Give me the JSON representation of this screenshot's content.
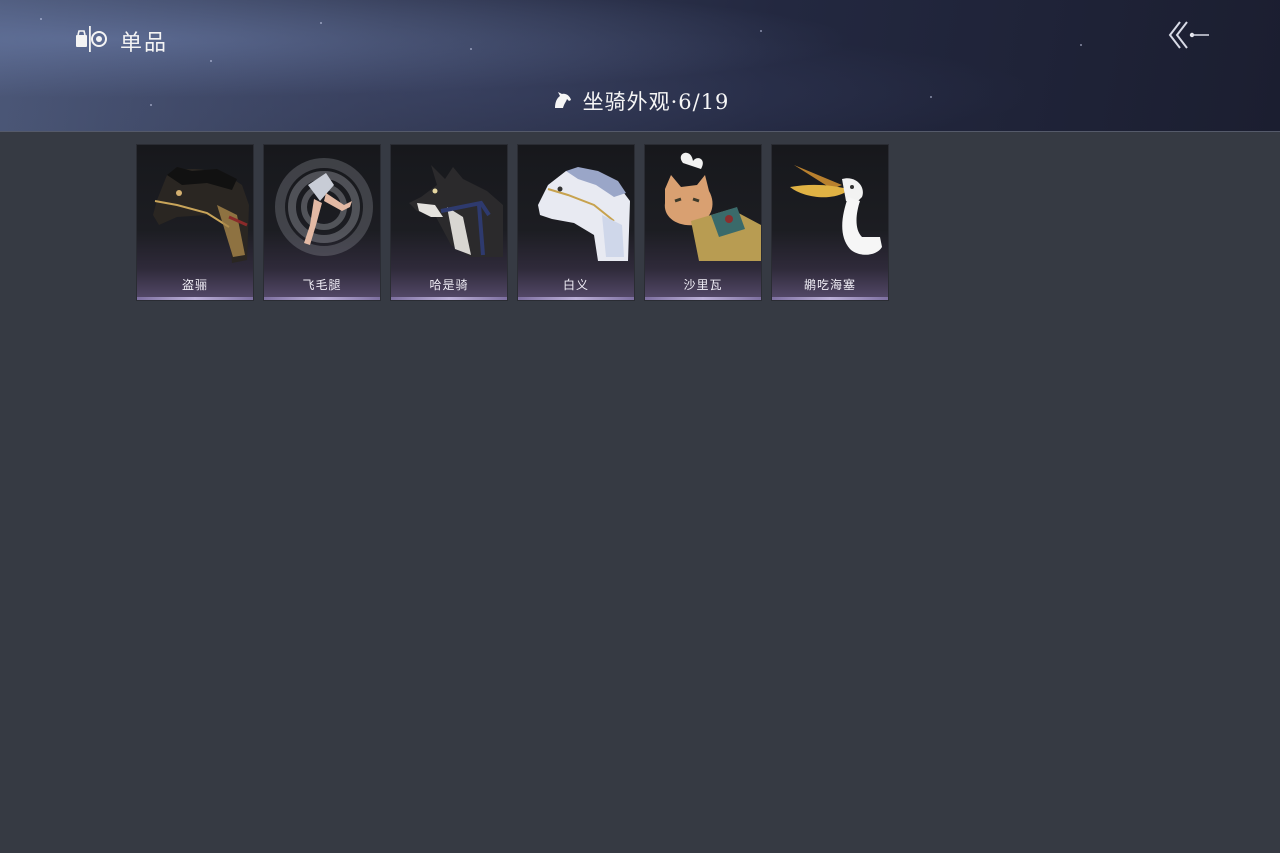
{
  "header": {
    "title": "单品",
    "section_title": "坐骑外观·6/19"
  },
  "items": [
    {
      "name": "盗骊",
      "icon": "armored-horse-icon"
    },
    {
      "name": "飞毛腿",
      "icon": "spinning-legs-icon"
    },
    {
      "name": "哈是骑",
      "icon": "husky-icon"
    },
    {
      "name": "白义",
      "icon": "white-horse-icon"
    },
    {
      "name": "沙里瓦",
      "icon": "armored-cat-icon"
    },
    {
      "name": "鹕吃海塞",
      "icon": "pelican-icon"
    }
  ],
  "colors": {
    "background": "#363a43",
    "card_accent": "#bcb0d8"
  }
}
